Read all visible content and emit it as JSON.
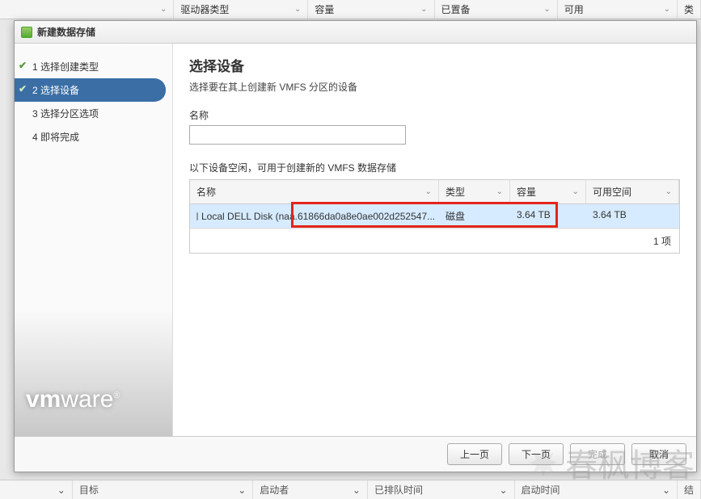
{
  "bg_header": {
    "cols": [
      "",
      "驱动器类型",
      "容量",
      "已置备",
      "可用",
      "类"
    ]
  },
  "bg_footer": {
    "cols": [
      "目标",
      "启动者",
      "已排队时间",
      "启动时间",
      "结"
    ]
  },
  "bg_arrow": "⌄",
  "modal": {
    "title": "新建数据存储"
  },
  "steps": [
    {
      "num": "1",
      "label": "选择创建类型",
      "checked": true,
      "active": false
    },
    {
      "num": "2",
      "label": "选择设备",
      "checked": true,
      "active": true
    },
    {
      "num": "3",
      "label": "选择分区选项",
      "checked": false,
      "active": false
    },
    {
      "num": "4",
      "label": "即将完成",
      "checked": false,
      "active": false
    }
  ],
  "logo": {
    "vm": "vm",
    "ware": "ware",
    "r": "®"
  },
  "content": {
    "heading": "选择设备",
    "subtitle": "选择要在其上创建新 VMFS 分区的设备",
    "name_label": "名称",
    "name_value": "",
    "hint": "以下设备空闲，可用于创建新的 VMFS 数据存储"
  },
  "table": {
    "columns": {
      "name": "名称",
      "type": "类型",
      "capacity": "容量",
      "free": "可用空间"
    },
    "row": {
      "name": "Local DELL Disk (naa.61866da0a8e0ae002d252547...",
      "type": "磁盘",
      "capacity": "3.64 TB",
      "free": "3.64 TB"
    },
    "footer": "1 项"
  },
  "buttons": {
    "back": "上一页",
    "next": "下一页",
    "finish": "完成",
    "cancel": "取消"
  },
  "watermark": "春枫博客"
}
